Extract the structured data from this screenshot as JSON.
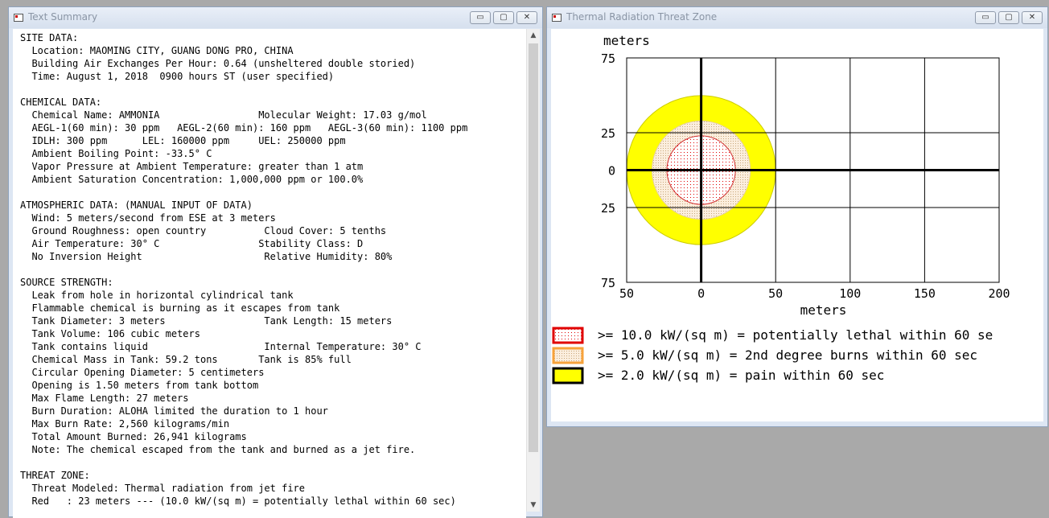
{
  "text_window": {
    "title": "Text Summary",
    "buttons": {
      "minimize": "▭",
      "maximize": "▢",
      "close": "✕"
    },
    "lines": [
      "SITE DATA:",
      "  Location: MAOMING CITY, GUANG DONG PRO, CHINA",
      "  Building Air Exchanges Per Hour: 0.64 (unsheltered double storied)",
      "  Time: August 1, 2018  0900 hours ST (user specified)",
      "",
      "CHEMICAL DATA:",
      "  Chemical Name: AMMONIA                 Molecular Weight: 17.03 g/mol",
      "  AEGL-1(60 min): 30 ppm   AEGL-2(60 min): 160 ppm   AEGL-3(60 min): 1100 ppm",
      "  IDLH: 300 ppm      LEL: 160000 ppm     UEL: 250000 ppm",
      "  Ambient Boiling Point: -33.5° C",
      "  Vapor Pressure at Ambient Temperature: greater than 1 atm",
      "  Ambient Saturation Concentration: 1,000,000 ppm or 100.0%",
      "",
      "ATMOSPHERIC DATA: (MANUAL INPUT OF DATA)",
      "  Wind: 5 meters/second from ESE at 3 meters",
      "  Ground Roughness: open country          Cloud Cover: 5 tenths",
      "  Air Temperature: 30° C                 Stability Class: D",
      "  No Inversion Height                     Relative Humidity: 80%",
      "",
      "SOURCE STRENGTH:",
      "  Leak from hole in horizontal cylindrical tank",
      "  Flammable chemical is burning as it escapes from tank",
      "  Tank Diameter: 3 meters                 Tank Length: 15 meters",
      "  Tank Volume: 106 cubic meters",
      "  Tank contains liquid                    Internal Temperature: 30° C",
      "  Chemical Mass in Tank: 59.2 tons       Tank is 85% full",
      "  Circular Opening Diameter: 5 centimeters",
      "  Opening is 1.50 meters from tank bottom",
      "  Max Flame Length: 27 meters",
      "  Burn Duration: ALOHA limited the duration to 1 hour",
      "  Max Burn Rate: 2,560 kilograms/min",
      "  Total Amount Burned: 26,941 kilograms",
      "  Note: The chemical escaped from the tank and burned as a jet fire.",
      "",
      "THREAT ZONE:",
      "  Threat Modeled: Thermal radiation from jet fire",
      "  Red   : 23 meters --- (10.0 kW/(sq m) = potentially lethal within 60 sec)"
    ]
  },
  "plot_window": {
    "title": "Thermal Radiation Threat Zone",
    "buttons": {
      "minimize": "▭",
      "maximize": "▢",
      "close": "✕"
    },
    "y_unit_label": "meters",
    "x_unit_label": "meters",
    "y_ticks": [
      "75",
      "25",
      "0",
      "25",
      "75"
    ],
    "x_ticks": [
      "50",
      "0",
      "50",
      "100",
      "150",
      "200"
    ],
    "zones": [
      {
        "label": ">= 10.0 kW/(sq m) = potentially lethal within 60 se",
        "radius_m": 23,
        "color": "#ff0000",
        "fill": "#ffe0e0"
      },
      {
        "label": ">= 5.0 kW/(sq m) = 2nd degree burns within 60 sec",
        "radius_m": 33,
        "color": "#f7a23a",
        "fill": "#f6e8cc"
      },
      {
        "label": ">= 2.0 kW/(sq m) = pain within 60 sec",
        "radius_m": 50,
        "color": "#000000",
        "fill": "#ffff00"
      }
    ],
    "x_range": [
      -50,
      200
    ],
    "y_range": [
      -75,
      75
    ]
  }
}
